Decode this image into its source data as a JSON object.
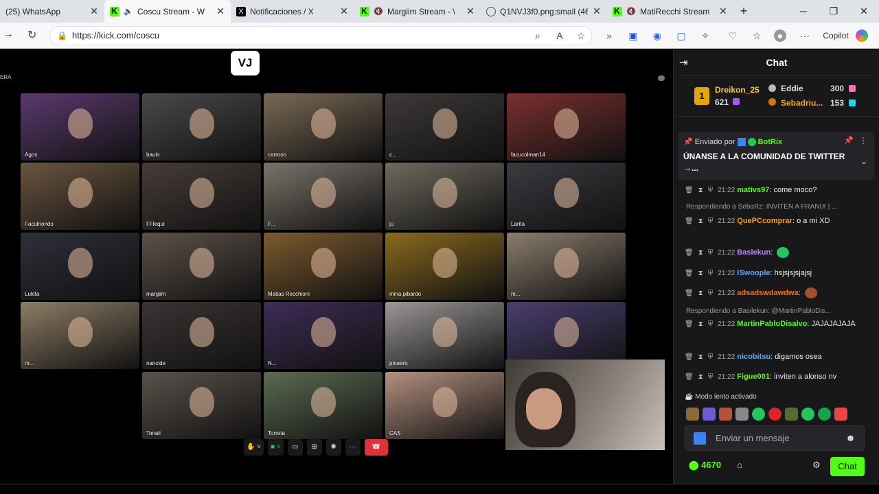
{
  "browser": {
    "tabs": [
      {
        "title": "(25) WhatsApp",
        "icon": "whatsapp-icon"
      },
      {
        "title": "Coscu Stream - W",
        "icon": "kick-icon",
        "audio": true,
        "active": true
      },
      {
        "title": "Notificaciones / X",
        "icon": "x-icon"
      },
      {
        "title": "Margiim Stream - \\",
        "icon": "kick-icon",
        "audio": true
      },
      {
        "title": "Q1NVJ3f0.png:small (46",
        "icon": "globe-icon"
      },
      {
        "title": "MatiRecchi Stream",
        "icon": "kick-icon",
        "audio": true
      }
    ],
    "new_tab": "+",
    "url": "https://kick.com/coscu",
    "copilot_label": "Copilot"
  },
  "stream": {
    "logo": "VJ",
    "corner_label": "ERA",
    "participants": [
      "Agos",
      "baulo",
      "carrooo",
      "c...",
      "facucolman14",
      "Faculriondo",
      "FFlequi",
      "F...",
      "ju",
      "Larita",
      "Lukita",
      "margiim",
      "Matias Recchioni",
      "mina pibardo",
      "m...",
      "m...",
      "nancide",
      "N...",
      "pineero",
      "",
      "Tonali",
      "Torreta",
      "CAS"
    ]
  },
  "chat": {
    "title": "Chat",
    "leaderboard": {
      "first": {
        "rank": "1",
        "name": "Dreikon_25",
        "points": "621"
      },
      "others": [
        {
          "name": "Eddie",
          "points": "300"
        },
        {
          "name": "Sebadriu...",
          "points": "153"
        }
      ]
    },
    "pinned": {
      "sent_by_label": "Enviado por",
      "sender": "BotRix",
      "message": "ÚNANSE A LA COMUNIDAD DE TWITTER →..."
    },
    "messages": [
      {
        "time": "21:22",
        "user": "mativs97",
        "text": "come moco?"
      },
      {
        "reply": "Respondiendo a SebaRz: INVITEN A FRANIX | ..."
      },
      {
        "time": "21:22",
        "user": "QuePCcomprar",
        "text": "o a mi XD"
      },
      {
        "time": "21:22",
        "user": "Baslekun",
        "text": ""
      },
      {
        "time": "21:22",
        "user": "lSwoople",
        "text": "hsjsjsjsjajsj"
      },
      {
        "time": "21:22",
        "user": "adsadswdawdwa",
        "text": ""
      },
      {
        "reply": "Respondiendo a Basilekun: @MartinPabloDis..."
      },
      {
        "time": "21:22",
        "user": "MartinPabloDisalvo",
        "text": "JAJAJAJAJA"
      },
      {
        "time": "21:22",
        "user": "nicobitsu",
        "text": "digamos osea"
      },
      {
        "time": "21:22",
        "user": "Figue001",
        "text": "inviten a alonso nv"
      }
    ],
    "slow_mode": "Modo lento activado",
    "input_placeholder": "Enviar un mensaje",
    "points": "4670",
    "send_label": "Chat"
  }
}
